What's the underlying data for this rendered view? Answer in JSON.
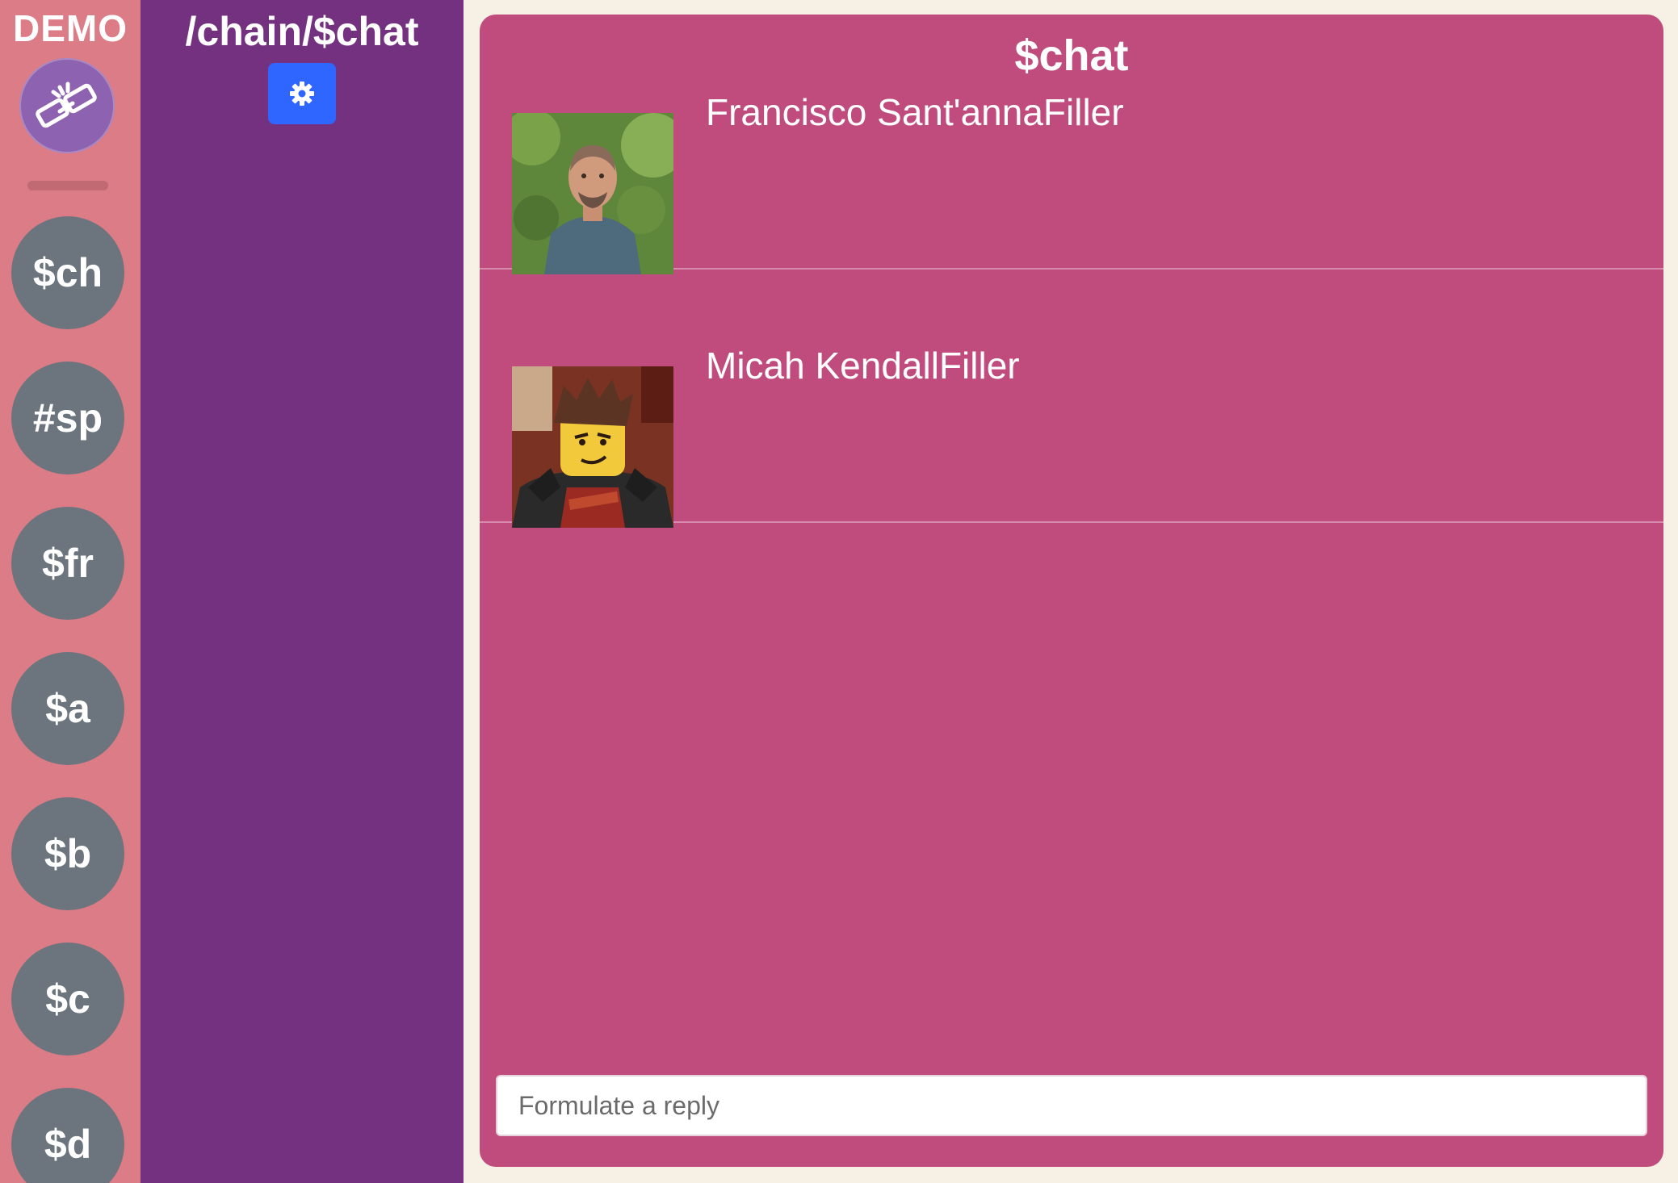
{
  "rail": {
    "title": "DEMO",
    "logo_icon": "chain-link-icon",
    "items": [
      {
        "label": "$ch"
      },
      {
        "label": "#sp"
      },
      {
        "label": "$fr"
      },
      {
        "label": "$a"
      },
      {
        "label": "$b"
      },
      {
        "label": "$c"
      },
      {
        "label": "$d"
      }
    ]
  },
  "channel_panel": {
    "title": "/chain/$chat",
    "settings_icon": "gear-icon"
  },
  "chat": {
    "title": "$chat",
    "messages": [
      {
        "name": "Francisco Sant'annaFiller",
        "avatar": "man-photo-avatar"
      },
      {
        "name": "Micah KendallFiller",
        "avatar": "lego-ninja-avatar"
      }
    ],
    "reply_placeholder": "Formulate a reply"
  },
  "colors": {
    "rail_bg": "#dc7c86",
    "channel_bg": "#74317f",
    "chat_bg": "#c04c7e",
    "settings_button": "#2f66ff",
    "rail_circle": "#6c757d",
    "page_bg": "#f6f1e4"
  }
}
